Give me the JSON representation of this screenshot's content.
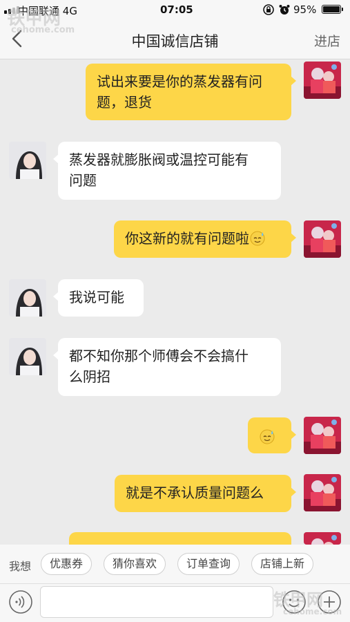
{
  "status": {
    "carrier": "中国联通",
    "network": "4G",
    "time": "07:05",
    "battery": "95%"
  },
  "header": {
    "title": "中国诚信店铺",
    "enter_shop": "进店"
  },
  "messages": [
    {
      "from": "me",
      "lines": [
        "试出来要是你的蒸发器有问",
        "题，退货"
      ]
    },
    {
      "from": "them",
      "lines": [
        "蒸发器就膨胀阀或温控可能有",
        "问题"
      ]
    },
    {
      "from": "me",
      "lines": [
        "你这新的就有问题啦"
      ],
      "emoji": "sweat-smile"
    },
    {
      "from": "them",
      "lines": [
        "我说可能"
      ]
    },
    {
      "from": "them",
      "lines": [
        "都不知你那个师傅会不会搞什",
        "么阴招"
      ]
    },
    {
      "from": "me",
      "lines": [],
      "emoji": "sweat-smile"
    },
    {
      "from": "me",
      "lines": [
        "就是不承认质量问题么"
      ]
    },
    {
      "from": "me",
      "lines": []
    }
  ],
  "quick": {
    "label": "我想",
    "chips": [
      "优惠券",
      "猜你喜欢",
      "订单查询",
      "店铺上新"
    ]
  },
  "watermark": {
    "top": "铁甲网",
    "top_url": "cehome.com",
    "bottom": "铁甲网",
    "bottom_url": "cehome.com"
  },
  "colors": {
    "my_bubble": "#fdd648",
    "their_bubble": "#ffffff",
    "background": "#ebebeb"
  }
}
